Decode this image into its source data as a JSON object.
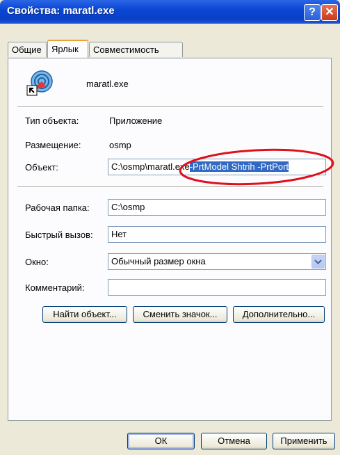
{
  "window": {
    "title": "Свойства: maratl.exe",
    "help_glyph": "?",
    "close_glyph": "✕"
  },
  "tabs": [
    {
      "label": "Общие",
      "active": false
    },
    {
      "label": "Ярлык",
      "active": true
    },
    {
      "label": "Совместимость",
      "active": false
    }
  ],
  "shortcut": {
    "name": "maratl.exe",
    "type_label": "Тип объекта:",
    "type_value": "Приложение",
    "location_label": "Размещение:",
    "location_value": "osmp",
    "target_label": "Объект:",
    "target_value_plain": "C:\\osmp\\maratl.exe",
    "target_value_selected": "-PrtModel Shtrih -PrtPort",
    "workdir_label": "Рабочая папка:",
    "workdir_value": "C:\\osmp",
    "hotkey_label": "Быстрый вызов:",
    "hotkey_value": "Нет",
    "window_label": "Окно:",
    "window_value": "Обычный размер окна",
    "comment_label": "Комментарий:",
    "comment_value": ""
  },
  "buttons": {
    "find_target": "Найти объект...",
    "change_icon": "Сменить значок...",
    "advanced": "Дополнительно...",
    "ok": "ОК",
    "cancel": "Отмена",
    "apply": "Применить"
  },
  "colors": {
    "annotation": "#e0101a",
    "selection": "#316ac5",
    "titlebar": "#0a47d4"
  }
}
